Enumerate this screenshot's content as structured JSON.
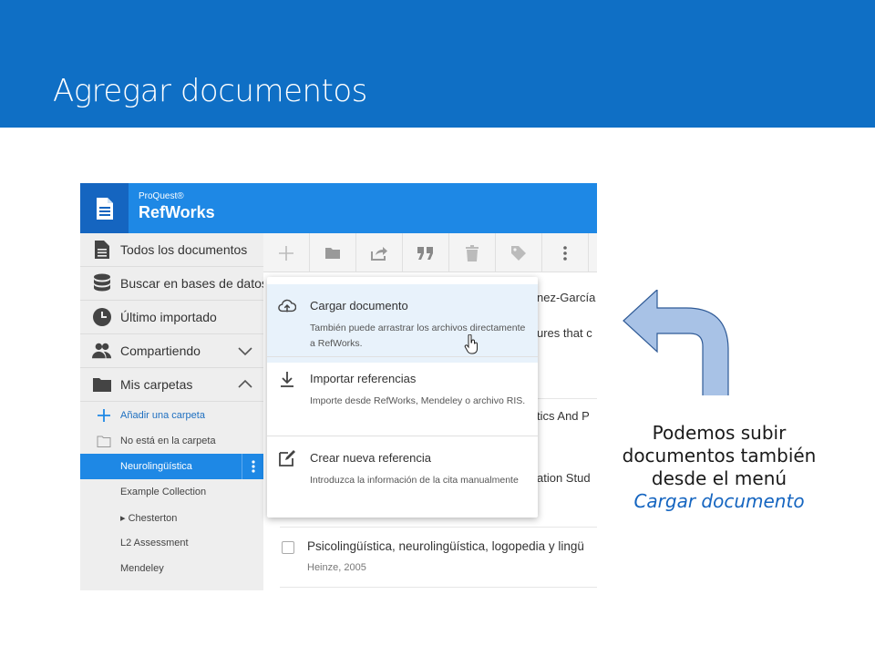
{
  "slide": {
    "title": "Agregar documentos",
    "header_color": "#0f6fc5"
  },
  "app": {
    "brand_small": "ProQuest®",
    "brand_big": "RefWorks",
    "accent": "#1e88e5"
  },
  "sidebar": {
    "items": [
      {
        "label": "Todos los documentos",
        "icon": "document-icon"
      },
      {
        "label": "Buscar en bases de datos",
        "icon": "database-icon"
      },
      {
        "label": "Último importado",
        "icon": "clock-icon"
      },
      {
        "label": "Compartiendo",
        "icon": "people-icon"
      },
      {
        "label": "Mis carpetas",
        "icon": "folder-icon"
      }
    ],
    "sub": {
      "add_folder": "Añadir una carpeta",
      "not_in_folder": "No está en la carpeta",
      "folders": [
        "Neurolingüística",
        "Example Collection",
        "▸ Chesterton",
        "L2 Assessment",
        "Mendeley"
      ]
    }
  },
  "toolbar": {
    "buttons": [
      "add-icon",
      "folder-icon",
      "share-icon",
      "quote-icon",
      "trash-icon",
      "tag-icon",
      "more-icon"
    ]
  },
  "list": {
    "fragments": [
      "nez-García y",
      "ures that c",
      "tics And P",
      "ation Stud"
    ],
    "row_title": "Psicolingüística, neurolingüística, logopedia y lingü",
    "row_author": "Heinze, 2005"
  },
  "dropdown": {
    "items": [
      {
        "title": "Cargar documento",
        "desc": "También puede arrastrar los archivos directamente a RefWorks.",
        "icon": "cloud-upload-icon"
      },
      {
        "title": "Importar referencias",
        "desc": "Importe desde RefWorks, Mendeley o archivo RIS.",
        "icon": "download-icon"
      },
      {
        "title": "Crear nueva referencia",
        "desc": "Introduzca la información de la cita manualmente",
        "icon": "edit-icon"
      }
    ]
  },
  "caption": {
    "text": "Podemos subir documentos también desde el menú",
    "link": "Cargar documento"
  }
}
